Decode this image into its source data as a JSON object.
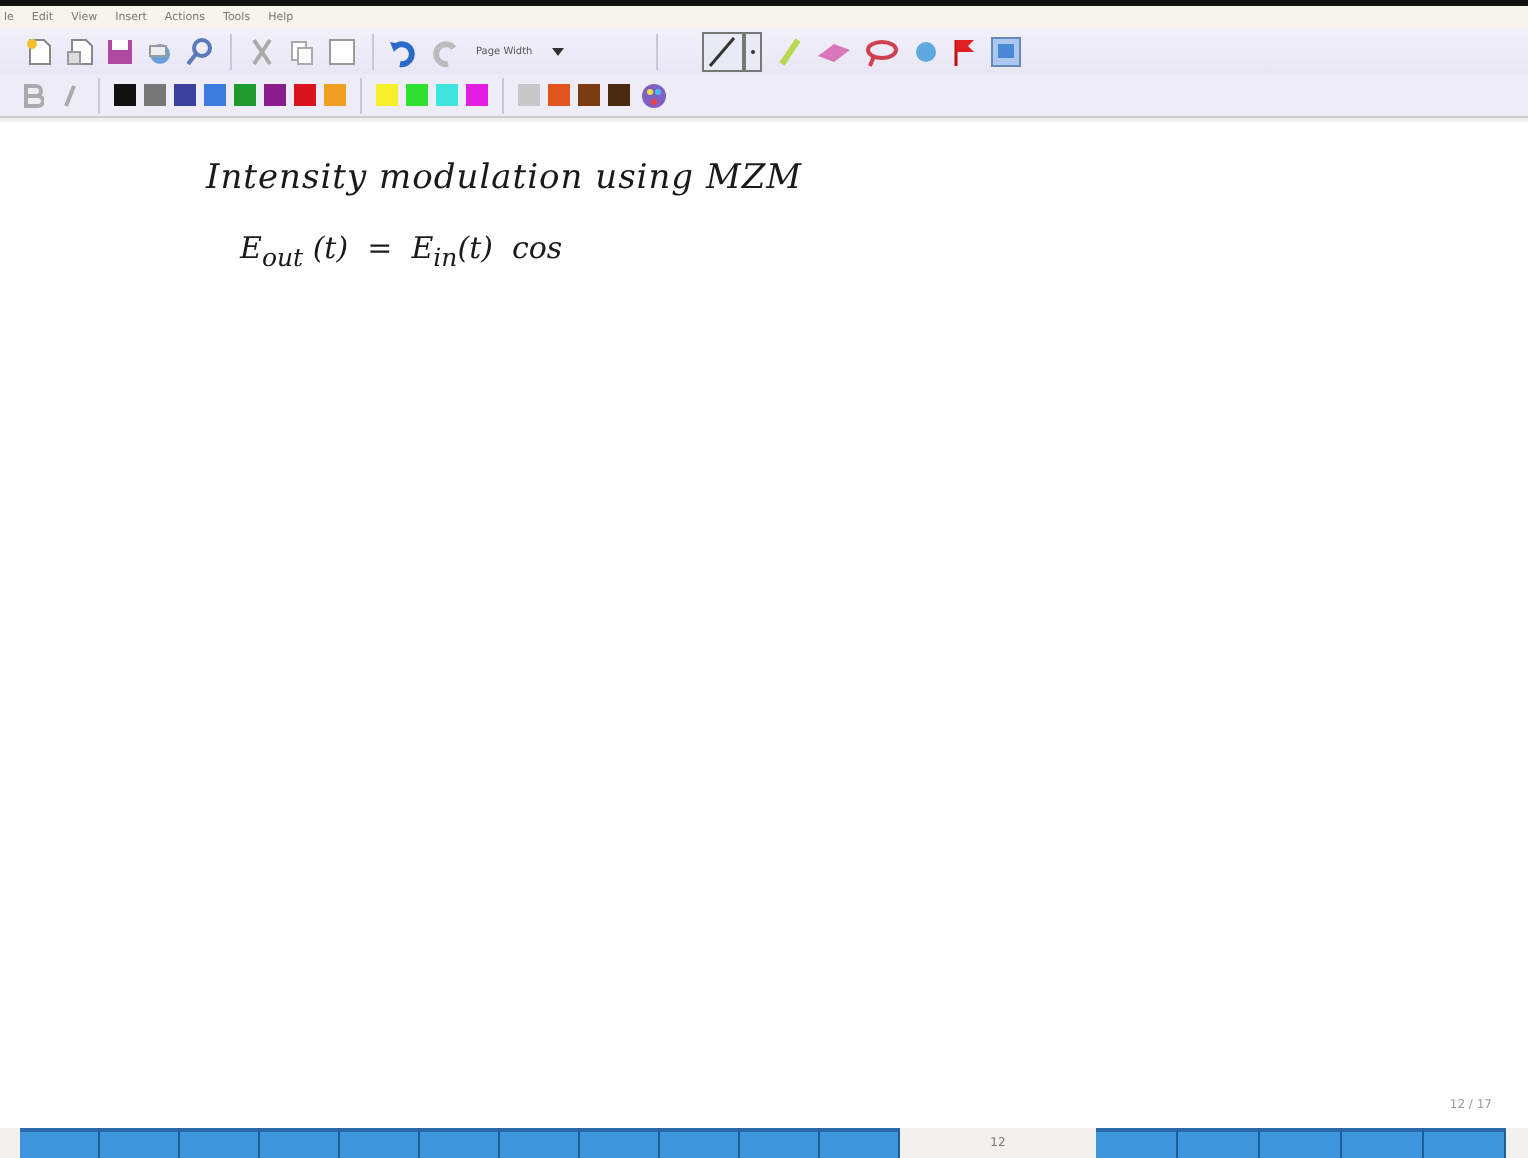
{
  "menu_bar": [
    "le",
    "Edit",
    "View",
    "Insert",
    "Actions",
    "Tools",
    "Help"
  ],
  "toolbar": {
    "zoom_dropdown": "Page Width"
  },
  "pen_colors": [
    {
      "color": "#111111"
    },
    {
      "color": "#777777"
    },
    {
      "color": "#3b3f9e"
    },
    {
      "color": "#3d7de0"
    },
    {
      "color": "#1f9a2e"
    },
    {
      "color": "#8a1d8e"
    },
    {
      "color": "#d8141c"
    },
    {
      "color": "#f0a020"
    },
    {
      "color": "#f6f02a"
    },
    {
      "color": "#2fe02f"
    },
    {
      "color": "#3fe6e0"
    },
    {
      "color": "#e21fe0"
    },
    {
      "color": "#c8c8c8"
    },
    {
      "color": "#e2561c"
    },
    {
      "color": "#7a3b12"
    },
    {
      "color": "#4a2a10"
    }
  ],
  "note": {
    "lines": [
      "Intensity modulation using MZM",
      "E$_{out}$ (t)  =  E$_{in}$(t)  cos"
    ]
  },
  "page_number": "12 / 17",
  "page_strip": {
    "label": "12"
  }
}
